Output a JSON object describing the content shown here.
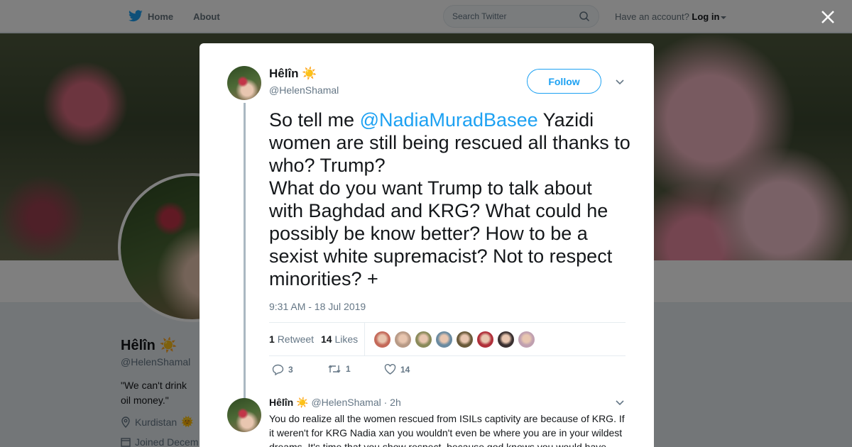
{
  "nav": {
    "home": "Home",
    "about": "About",
    "search_placeholder": "Search Twitter",
    "account_prompt": "Have an account?",
    "login": "Log in"
  },
  "profile": {
    "name": "Hêlîn",
    "name_emoji": "☀️",
    "handle": "@HelenShamal",
    "bio": "\"We can't drink oil money.\"",
    "location": "Kurdistan",
    "location_emoji": "🌞",
    "joined": "Joined Decem"
  },
  "tweet": {
    "name": "Hêlîn",
    "name_emoji": "☀️",
    "handle": "@HelenShamal",
    "follow_label": "Follow",
    "text_before": "So tell me ",
    "mention": "@NadiaMuradBasee",
    "text_after": " Yazidi women are still being rescued all thanks to who? Trump?\nWhat do you want Trump to talk about with Baghdad and KRG? What could he possibly be know better? How to be a sexist white supremacist? Not to respect minorities? +",
    "timestamp": "9:31 AM - 18 Jul 2019",
    "retweets_count": "1",
    "retweets_label": "Retweet",
    "likes_count": "14",
    "likes_label": "Likes",
    "liker_avatars": [
      "#c46a5a",
      "#b89a86",
      "#8a8a5a",
      "#6a8aa0",
      "#6a5a3a",
      "#b0303a",
      "#3a3030",
      "#c0a0b0"
    ],
    "reply_count": "3",
    "retweet_count": "1",
    "like_count": "14"
  },
  "reply": {
    "name": "Hêlîn",
    "name_emoji": "☀️",
    "handle": "@HelenShamal",
    "time": "· 2h",
    "text": "You do realize all the women rescued from ISILs captivity are because of KRG. If it weren't for KRG Nadia xan you wouldn't even be where you are in your wildest dreams. It's time that you show respect, because god knows you would have"
  },
  "colors": {
    "accent": "#1da1f2",
    "text": "#14171a",
    "muted": "#657786"
  }
}
